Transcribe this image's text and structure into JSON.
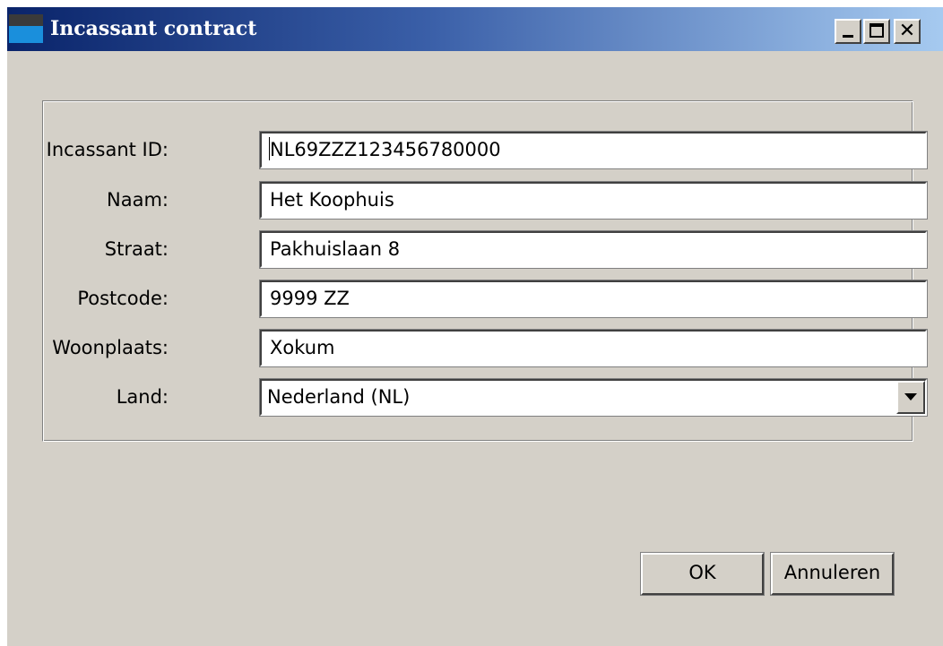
{
  "window": {
    "title": "Incassant contract",
    "controls": {
      "minimize_icon": "minimize-icon",
      "maximize_icon": "maximize-icon",
      "close_icon": "close-icon",
      "close_glyph": "✕"
    }
  },
  "form": {
    "fields": [
      {
        "label": "Incassant ID:",
        "value": "NL69ZZZ123456780000"
      },
      {
        "label": "Naam:",
        "value": "Het Koophuis"
      },
      {
        "label": "Straat:",
        "value": "Pakhuislaan 8"
      },
      {
        "label": "Postcode:",
        "value": "9999 ZZ"
      },
      {
        "label": "Woonplaats:",
        "value": "Xokum"
      }
    ],
    "country": {
      "label": "Land:",
      "value": "Nederland (NL)"
    }
  },
  "buttons": {
    "ok": "OK",
    "cancel": "Annuleren"
  },
  "colors": {
    "title_gradient_start": "#0a246a",
    "title_gradient_end": "#a6caf0",
    "window_bg": "#d4d0c8"
  }
}
